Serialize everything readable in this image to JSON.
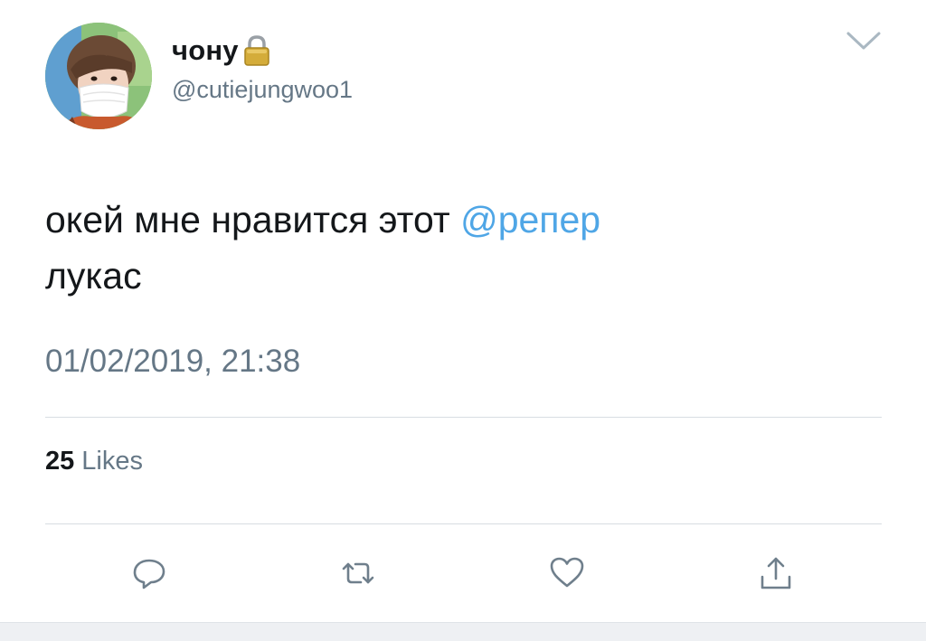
{
  "tweet": {
    "author": {
      "display_name": "чону",
      "handle": "@cutiejungwoo1",
      "protected_icon": "lock-icon",
      "avatar_icon": "profile-photo"
    },
    "text_before_mention": "окей мне нравится этот ",
    "mention": "@репер",
    "text_after_mention": "лукас",
    "timestamp": "01/02/2019, 21:38",
    "likes": {
      "count": "25",
      "label": "Likes"
    },
    "menu_icon": "chevron-down-icon"
  },
  "actions": [
    {
      "name": "reply",
      "icon": "reply-icon"
    },
    {
      "name": "retweet",
      "icon": "retweet-icon"
    },
    {
      "name": "like",
      "icon": "heart-icon"
    },
    {
      "name": "share",
      "icon": "share-icon"
    }
  ],
  "colors": {
    "text": "#14171a",
    "secondary": "#657786",
    "link": "#4fa6e6",
    "divider": "#d8dde2",
    "lock_gold": "#c9a227"
  }
}
